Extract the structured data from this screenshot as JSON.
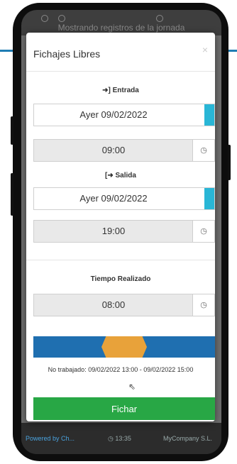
{
  "background": {
    "header_text": "Mostrando registros de la jornada",
    "footer_left": "Powered by Ch...",
    "footer_time": "13:35",
    "footer_right": "MyCompany S.L."
  },
  "modal": {
    "title": "Fichajes Libres",
    "close": "×",
    "entrada": {
      "label": "Entrada",
      "date": "Ayer 09/02/2022",
      "time": "09:00"
    },
    "salida": {
      "label": "Salida",
      "date": "Ayer 09/02/2022",
      "time": "19:00"
    },
    "tiempo": {
      "label": "Tiempo Realizado",
      "value": "08:00"
    },
    "no_trabajado": "No trabajado: 09/02/2022 13:00 - 09/02/2022 15:00",
    "fichar_label": "Fichar"
  },
  "colors": {
    "accent": "#29b6d6",
    "bar": "#1f6fb0",
    "handle": "#e8a23a",
    "submit": "#28a745"
  }
}
